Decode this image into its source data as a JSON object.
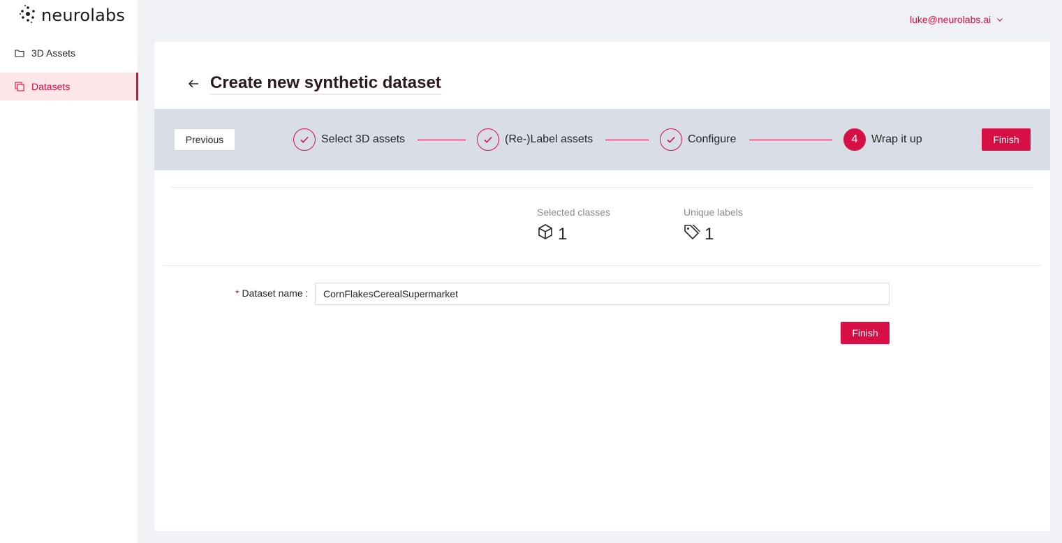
{
  "app": {
    "logo_text": "neurolabs",
    "logo_icon": "neurolabs-logo-icon"
  },
  "sidebar": {
    "items": [
      {
        "label": "3D Assets",
        "icon": "folder-icon",
        "selected": false
      },
      {
        "label": "Datasets",
        "icon": "copy-icon",
        "selected": true
      }
    ]
  },
  "header": {
    "user_email": "luke@neurolabs.ai",
    "user_menu_icon": "chevron-down-icon"
  },
  "page": {
    "title": "Create new synthetic dataset",
    "back_icon": "arrow-left-icon"
  },
  "steps": {
    "previous_label": "Previous",
    "finish_label": "Finish",
    "items": [
      {
        "label": "Select 3D assets",
        "status": "finished",
        "icon": "check-icon"
      },
      {
        "label": "(Re-)Label assets",
        "status": "finished",
        "icon": "check-icon"
      },
      {
        "label": "Configure",
        "status": "finished",
        "icon": "check-icon"
      },
      {
        "label": "Wrap it up",
        "status": "active",
        "number": "4"
      }
    ]
  },
  "stats": {
    "selected_classes": {
      "title": "Selected classes",
      "value": "1",
      "icon": "cube-icon"
    },
    "unique_labels": {
      "title": "Unique labels",
      "value": "1",
      "icon": "tags-icon"
    }
  },
  "form": {
    "dataset_name_label": "Dataset name",
    "dataset_name_value": "CornFlakesCerealSupermarket",
    "required_mark": "*",
    "finish_label": "Finish"
  },
  "colors": {
    "accent": "#d60f45",
    "steps_bg": "#d9dde5",
    "page_bg": "#f0f1f5"
  }
}
